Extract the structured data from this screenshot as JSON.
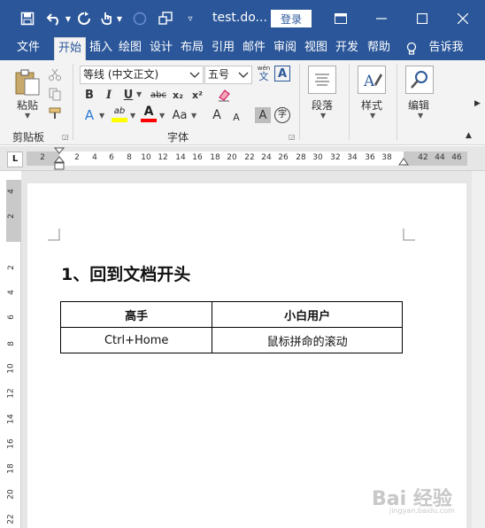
{
  "titlebar": {
    "doc_title": "test.do...",
    "login_label": "登录"
  },
  "tabs": [
    {
      "label": "文件"
    },
    {
      "label": "开始"
    },
    {
      "label": "插入"
    },
    {
      "label": "绘图"
    },
    {
      "label": "设计"
    },
    {
      "label": "布局"
    },
    {
      "label": "引用"
    },
    {
      "label": "邮件"
    },
    {
      "label": "审阅"
    },
    {
      "label": "视图"
    },
    {
      "label": "开发"
    },
    {
      "label": "帮助"
    },
    {
      "label": "告诉我"
    }
  ],
  "ribbon": {
    "paste_label": "粘贴",
    "clipboard_group": "剪贴板",
    "font_name": "等线 (中文正文)",
    "font_size": "五号",
    "font_group": "字体",
    "phonetic_label": "wén",
    "phonetic_char": "文",
    "bold": "B",
    "italic": "I",
    "underline": "U",
    "strike": "abc",
    "sub": "x₂",
    "sup": "x²",
    "text_effect": "A",
    "highlight": "ab",
    "font_color": "A",
    "change_case": "Aa",
    "grow": "A",
    "shrink": "A",
    "char_shade": "A",
    "enclose": "字",
    "border_char": "A",
    "paragraph_label": "段落",
    "styles_label": "样式",
    "editing_label": "编辑"
  },
  "ruler": {
    "tab_selector": "L",
    "h_numbers": [
      "2",
      "2",
      "4",
      "6",
      "8",
      "10",
      "12",
      "14",
      "16",
      "18",
      "20",
      "22",
      "24",
      "26",
      "28",
      "30",
      "32",
      "34",
      "36",
      "38",
      "42",
      "44",
      "46"
    ],
    "v_numbers": [
      "4",
      "2",
      "2",
      "4",
      "6",
      "8",
      "10",
      "12",
      "14",
      "16",
      "18",
      "20",
      "22"
    ]
  },
  "document": {
    "heading": "1、回到文档开头",
    "table": [
      [
        "高手",
        "小白用户"
      ],
      [
        "Ctrl+Home",
        "鼠标拼命的滚动"
      ]
    ]
  },
  "colors": {
    "brand": "#2b579a",
    "highlight_yellow": "#ffff00",
    "font_red": "#ff0000"
  }
}
